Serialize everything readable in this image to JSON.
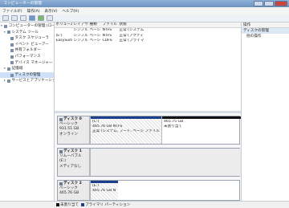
{
  "window": {
    "title": "コンピューターの管理"
  },
  "menu": [
    "ファイル(F)",
    "操作(A)",
    "表示(V)",
    "ヘルプ(H)"
  ],
  "tree": [
    {
      "label": "コンピューターの管理 (ローカル)",
      "indent": 0,
      "icon": "computer-management-icon"
    },
    {
      "label": "システム ツール",
      "indent": 1,
      "icon": "tools-icon"
    },
    {
      "label": "タスク スケジューラ",
      "indent": 2,
      "icon": "task-scheduler-icon"
    },
    {
      "label": "イベント ビューアー",
      "indent": 2,
      "icon": "event-viewer-icon"
    },
    {
      "label": "共有フォルダー",
      "indent": 2,
      "icon": "shared-folder-icon"
    },
    {
      "label": "パフォーマンス",
      "indent": 2,
      "icon": "performance-icon"
    },
    {
      "label": "デバイス マネージャー",
      "indent": 2,
      "icon": "device-manager-icon"
    },
    {
      "label": "記憶域",
      "indent": 1,
      "icon": "storage-icon"
    },
    {
      "label": "ディスクの管理",
      "indent": 2,
      "icon": "disk-management-icon",
      "selected": true
    },
    {
      "label": "サービスとアプリケーション",
      "indent": 1,
      "icon": "services-icon"
    }
  ],
  "volumes": {
    "headers": [
      "ボリューム",
      "レイアウト",
      "種類",
      "ファイル システム",
      "状態",
      ""
    ],
    "rows": [
      [
        "",
        "シンプル",
        "ベーシック",
        "NTFS",
        "正常 (システム, ブート, ページ ファイル, アクティブ",
        ""
      ],
      [
        "(E:)",
        "シンプル",
        "ベーシック",
        "NTFS",
        "正常 (アクティブ, プライマリ パーティション)",
        ""
      ],
      [
        "EasySuite (F:)",
        "シンプル",
        "ベーシック",
        "CDFS",
        "正常 (プライマリ パーティション)",
        ""
      ]
    ]
  },
  "actions": {
    "header": "操作",
    "section": "ディスクの管理",
    "item": "他の操作"
  },
  "disks": [
    {
      "name": "ディスク 0",
      "type": "ベーシック",
      "size": "931.51 GB",
      "status": "オンライン",
      "partitions": [
        {
          "name": "(C:)",
          "size": "465.76 GB NTFS",
          "status": "正常 (システム, ブート, ページ ファイル",
          "bar": "blue"
        },
        {
          "name": "",
          "size": "465.75 GB",
          "status": "未割り当て",
          "bar": "black"
        }
      ]
    },
    {
      "name": "ディスク 1",
      "type": "リムーバブル (E:)",
      "size": "",
      "status": "メディアなし",
      "partitions": []
    },
    {
      "name": "ディスク 2",
      "type": "ベーシック",
      "size": "465.76 GB",
      "status": "",
      "partitions": [
        {
          "name": "(E:)",
          "size": "465.76 GB NTFS",
          "status": "",
          "bar": "blue"
        }
      ]
    }
  ],
  "legend": [
    {
      "label": "未割り当て",
      "color": "#111111"
    },
    {
      "label": "プライマリ パーティション",
      "color": "#1c3f8c"
    }
  ]
}
